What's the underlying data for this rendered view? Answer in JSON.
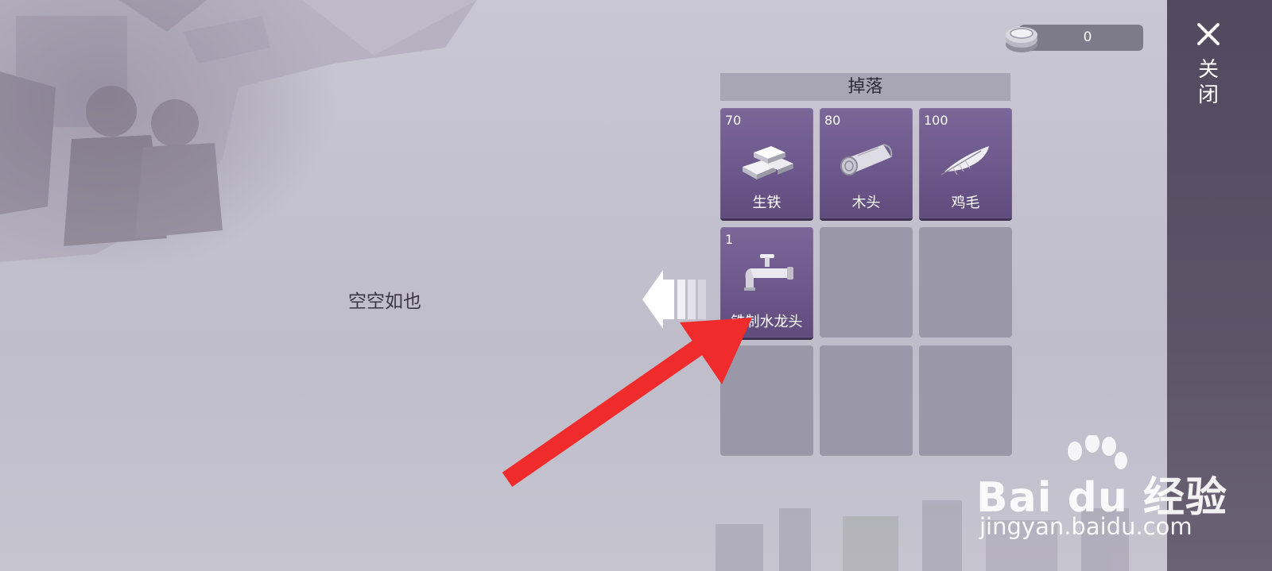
{
  "currency": {
    "value": "0",
    "icon": "coin-icon"
  },
  "close": {
    "label": "关闭",
    "icon": "close-icon"
  },
  "drops": {
    "title": "掉落",
    "slots": [
      {
        "count": "70",
        "name": "生铁",
        "icon": "iron-ingot-icon"
      },
      {
        "count": "80",
        "name": "木头",
        "icon": "wood-log-icon"
      },
      {
        "count": "100",
        "name": "鸡毛",
        "icon": "feather-icon"
      },
      {
        "count": "1",
        "name": "铁制水龙头",
        "icon": "faucet-icon"
      }
    ]
  },
  "inventory": {
    "empty_text": "空空如也"
  },
  "watermark": {
    "brand": "Bai du 经验",
    "url": "jingyan.baidu.com"
  },
  "colors": {
    "slot_filled": "#6b578a",
    "slot_empty": "#9a98a8",
    "annotation_arrow": "#f02b2b",
    "close_bar": "#53495f"
  }
}
